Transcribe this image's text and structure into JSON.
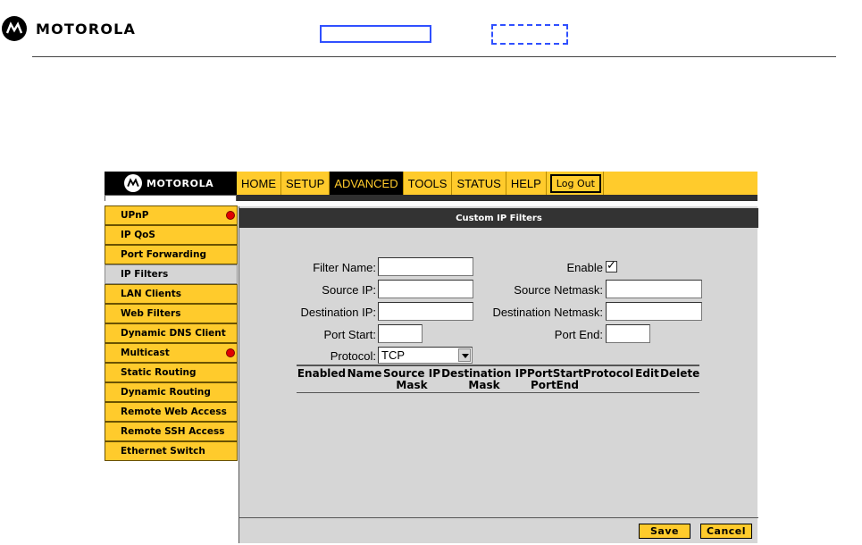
{
  "page": {
    "brand": "MOTOROLA"
  },
  "router": {
    "brand": "MOTOROLA",
    "nav": [
      "HOME",
      "SETUP",
      "ADVANCED",
      "TOOLS",
      "STATUS",
      "HELP"
    ],
    "active_nav": "ADVANCED",
    "logout_label": "Log Out",
    "sidebar": [
      {
        "label": "UPnP",
        "badge": true
      },
      {
        "label": "IP QoS",
        "badge": false
      },
      {
        "label": "Port Forwarding",
        "badge": false
      },
      {
        "label": "IP Filters",
        "badge": false,
        "active": true
      },
      {
        "label": "LAN Clients",
        "badge": false
      },
      {
        "label": "Web Filters",
        "badge": false
      },
      {
        "label": "Dynamic DNS Client",
        "badge": false
      },
      {
        "label": "Multicast",
        "badge": true
      },
      {
        "label": "Static Routing",
        "badge": false
      },
      {
        "label": "Dynamic Routing",
        "badge": false
      },
      {
        "label": "Remote Web Access",
        "badge": false
      },
      {
        "label": "Remote SSH Access",
        "badge": false
      },
      {
        "label": "Ethernet Switch",
        "badge": false
      }
    ],
    "panel_title": "Custom IP Filters",
    "form": {
      "filter_name_label": "Filter Name:",
      "filter_name_value": "",
      "enable_label": "Enable",
      "enable_checked": true,
      "source_ip_label": "Source IP:",
      "source_ip_value": "",
      "source_netmask_label": "Source Netmask:",
      "source_netmask_value": "",
      "dest_ip_label": "Destination IP:",
      "dest_ip_value": "",
      "dest_netmask_label": "Destination Netmask:",
      "dest_netmask_value": "",
      "port_start_label": "Port Start:",
      "port_start_value": "",
      "port_end_label": "Port End:",
      "port_end_value": "",
      "protocol_label": "Protocol:",
      "protocol_value": "TCP"
    },
    "table_headers": [
      {
        "l1": "Enabled",
        "l2": ""
      },
      {
        "l1": "Name",
        "l2": ""
      },
      {
        "l1": "Source IP",
        "l2": "Mask"
      },
      {
        "l1": "Destination IP",
        "l2": "Mask"
      },
      {
        "l1": "PortStart",
        "l2": "PortEnd"
      },
      {
        "l1": "Protocol",
        "l2": ""
      },
      {
        "l1": "Edit",
        "l2": ""
      },
      {
        "l1": "Delete",
        "l2": ""
      }
    ],
    "save_label": "Save",
    "cancel_label": "Cancel"
  },
  "colors": {
    "accent_yellow": "#ffcb2c",
    "dark": "#333333",
    "panel_gray": "#d6d6d6",
    "badge_red": "#e10000",
    "frame_blue": "#3050ff"
  }
}
